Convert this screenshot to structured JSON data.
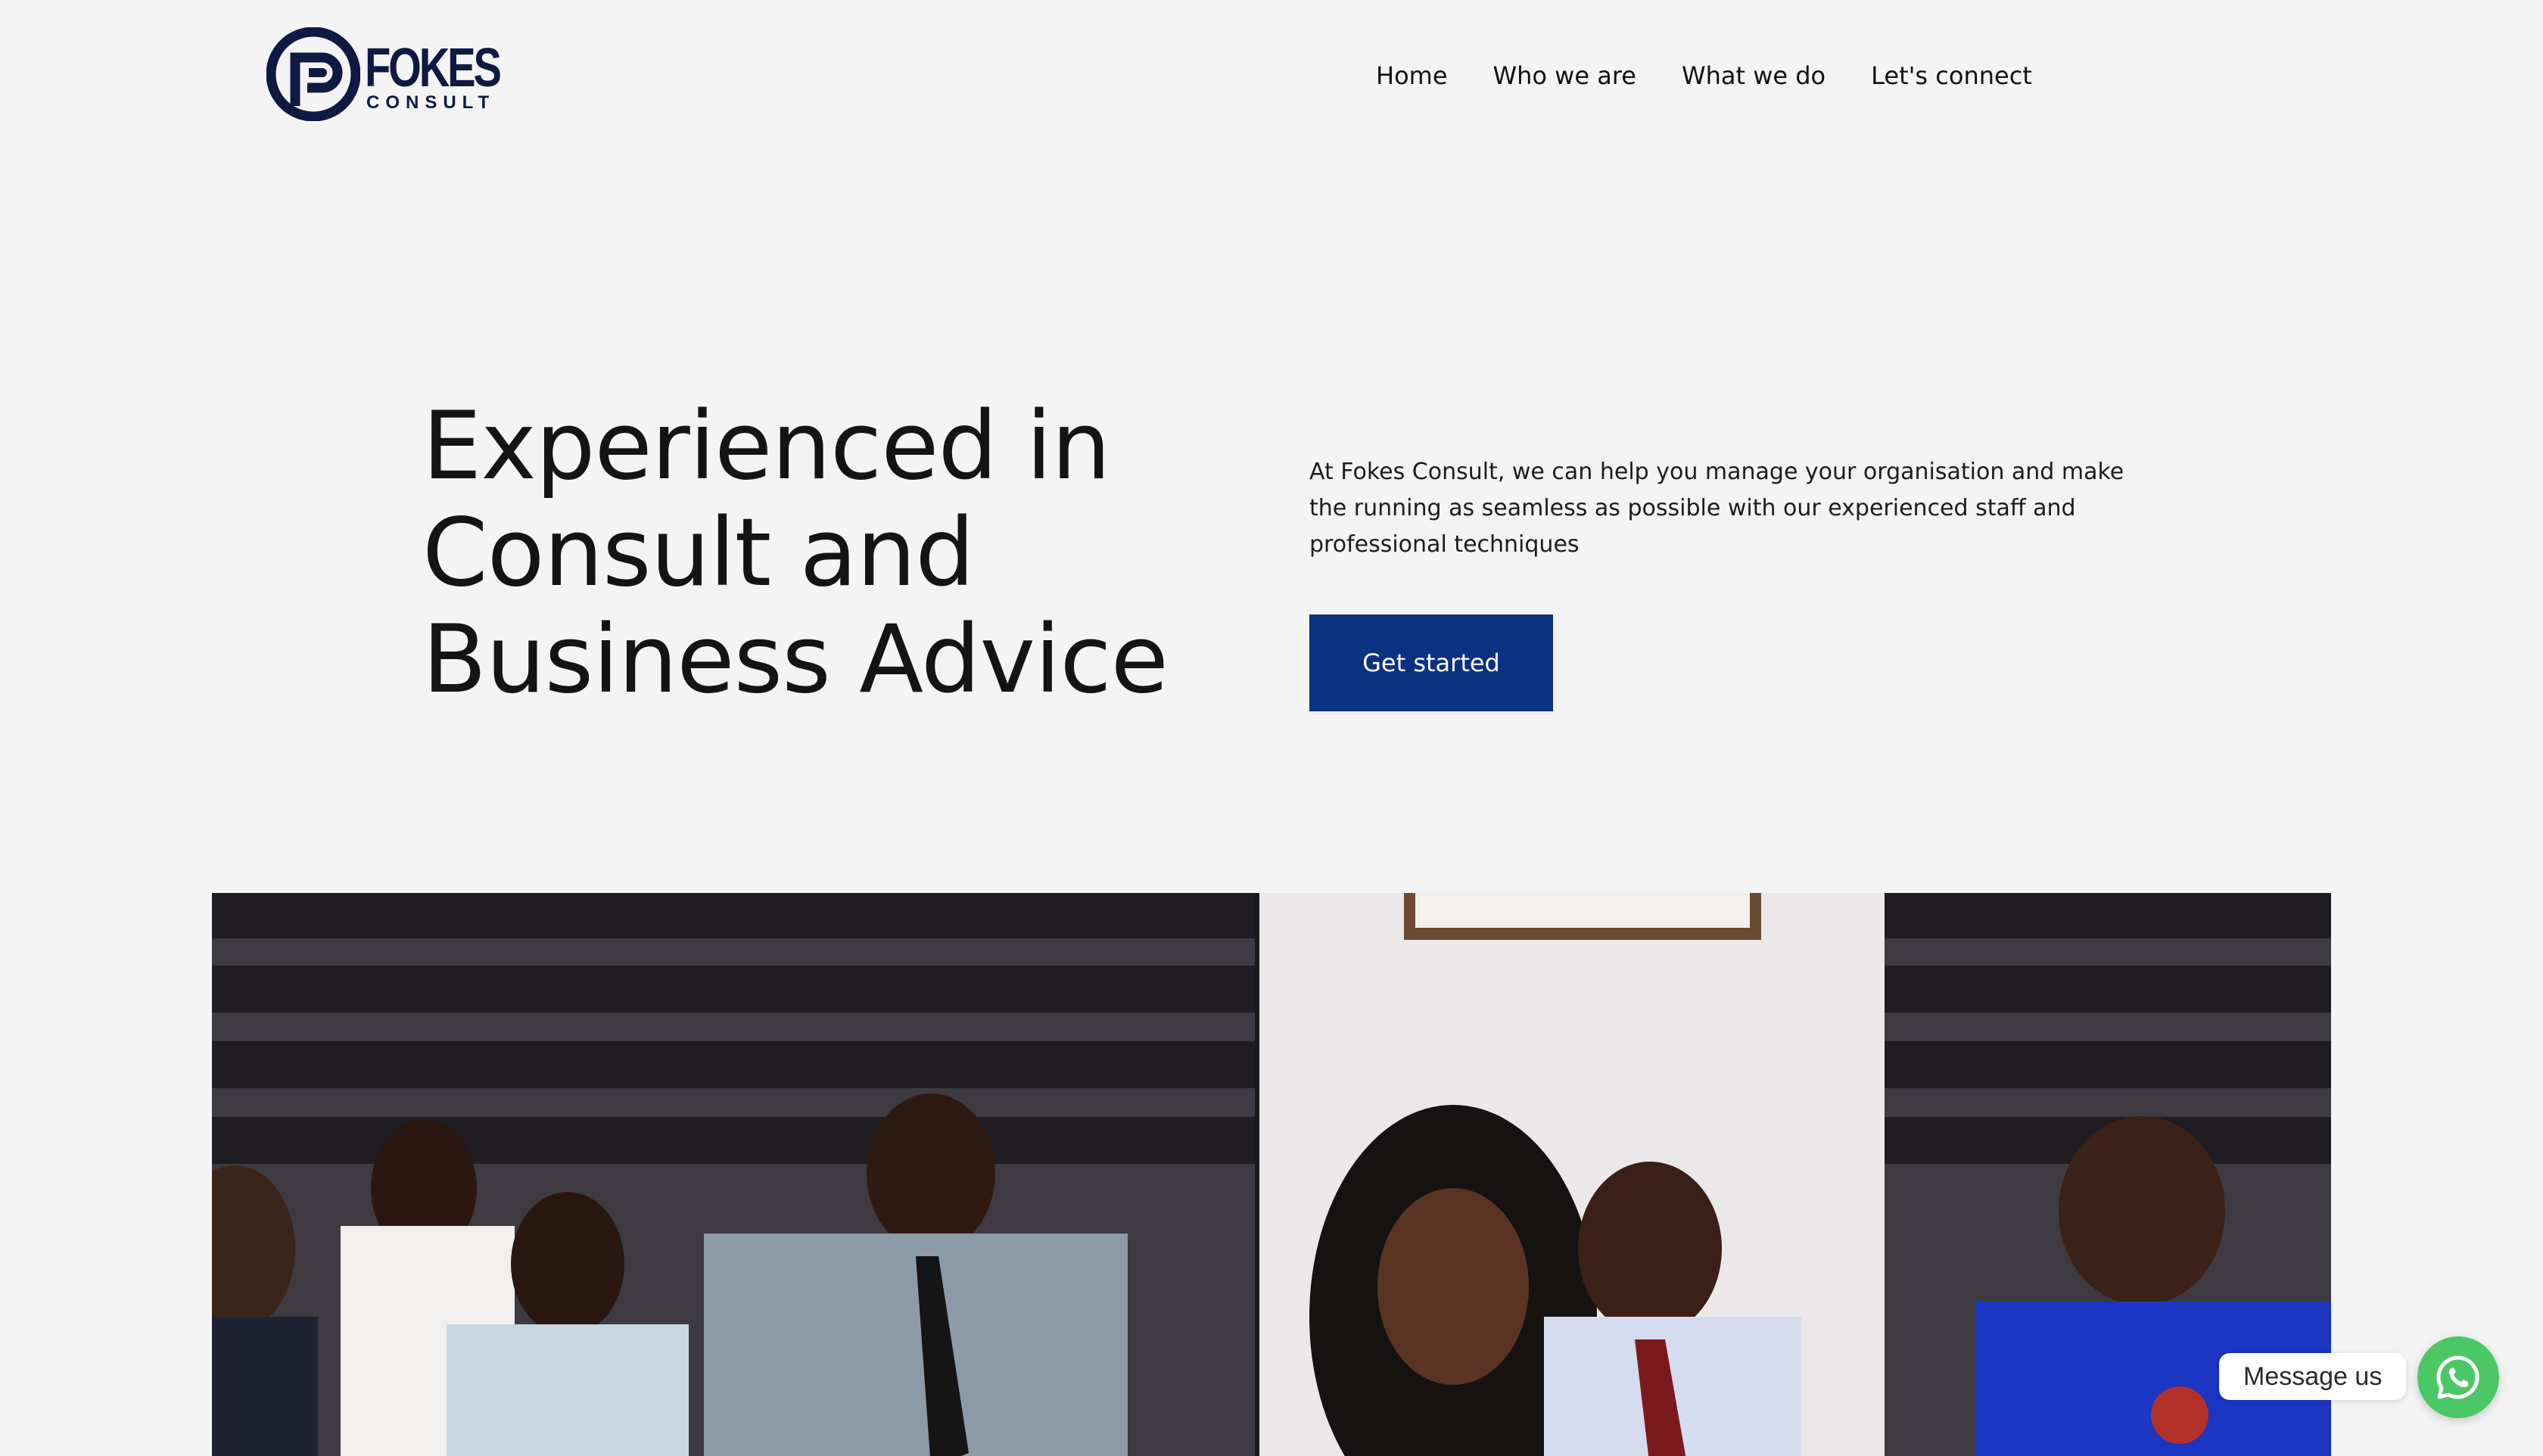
{
  "brand": {
    "name": "FOKES",
    "sub": "CONSULT",
    "color": "#0e1a44"
  },
  "nav": {
    "items": [
      {
        "label": "Home"
      },
      {
        "label": "Who we are"
      },
      {
        "label": "What we do"
      },
      {
        "label": "Let's connect"
      }
    ]
  },
  "hero": {
    "title": "Experienced in Consult and Business Advice",
    "description": "At Fokes Consult, we can help you manage your organisation and make the running as seamless as possible with our experienced staff and professional techniques",
    "cta_label": "Get started",
    "cta_color": "#0b3280"
  },
  "photo": {
    "icon": "team-photo"
  },
  "chat": {
    "label": "Message us",
    "icon": "whatsapp-icon",
    "color": "#4cc766"
  }
}
